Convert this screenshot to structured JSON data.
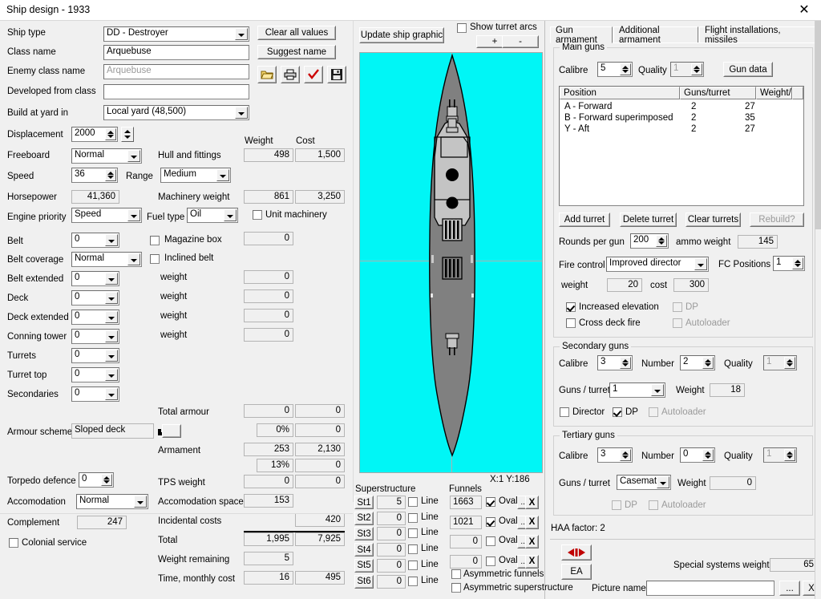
{
  "window": {
    "title": "Ship design - 1933",
    "close_icon": "close-icon"
  },
  "left": {
    "ship_type": {
      "label": "Ship type",
      "value": "DD - Destroyer"
    },
    "class_name": {
      "label": "Class name",
      "value": "Arquebuse"
    },
    "enemy_class_name": {
      "label": "Enemy class name",
      "value": "Arquebuse"
    },
    "developed_from_class": {
      "label": "Developed from class",
      "value": ""
    },
    "build_at_yard": {
      "label": "Build at yard in",
      "value": "Local yard (48,500)"
    },
    "displacement": {
      "label": "Displacement",
      "value": "2000"
    },
    "freeboard": {
      "label": "Freeboard",
      "value": "Normal"
    },
    "speed": {
      "label": "Speed",
      "value": "36"
    },
    "range": {
      "label": "Range",
      "value": "Medium"
    },
    "horsepower": {
      "label": "Horsepower",
      "value": "41,360"
    },
    "engine_priority": {
      "label": "Engine priority",
      "value": "Speed"
    },
    "fuel_type": {
      "label": "Fuel type",
      "value": "Oil"
    },
    "belt": {
      "label": "Belt",
      "value": "0"
    },
    "belt_coverage": {
      "label": "Belt coverage",
      "value": "Normal"
    },
    "belt_extended": {
      "label": "Belt extended",
      "value": "0"
    },
    "deck": {
      "label": "Deck",
      "value": "0"
    },
    "deck_extended": {
      "label": "Deck extended",
      "value": "0"
    },
    "conning_tower": {
      "label": "Conning tower",
      "value": "0"
    },
    "turrets": {
      "label": "Turrets",
      "value": "0"
    },
    "turret_top": {
      "label": "Turret top",
      "value": "0"
    },
    "secondaries": {
      "label": "Secondaries",
      "value": "0"
    },
    "armour_scheme": {
      "label": "Armour scheme",
      "value": "Sloped deck"
    },
    "torpedo_defence": {
      "label": "Torpedo defence",
      "value": "0"
    },
    "accomodation": {
      "label": "Accomodation",
      "value": "Normal"
    },
    "complement": {
      "label": "Complement",
      "value": "247"
    },
    "colonial_service": {
      "label": "Colonial service",
      "checked": false
    },
    "magazine_box": {
      "label": "Magazine box",
      "checked": false
    },
    "inclined_belt": {
      "label": "Inclined belt",
      "checked": false
    },
    "unit_machinery": {
      "label": "Unit machinery",
      "checked": false
    },
    "weight_labels": {
      "weight": "Weight",
      "cost": "Cost"
    },
    "rows": [
      {
        "label": "Hull and fittings",
        "weight": "498",
        "cost": "1,500"
      },
      {
        "label": "Machinery weight",
        "weight": "861",
        "cost": "3,250"
      },
      {
        "label": "weight",
        "weight": "0",
        "cost": ""
      },
      {
        "label": "weight",
        "weight": "0",
        "cost": ""
      },
      {
        "label": "weight",
        "weight": "0",
        "cost": ""
      },
      {
        "label": "weight",
        "weight": "0",
        "cost": ""
      }
    ],
    "total_armour": {
      "label": "Total armour",
      "weight": "0",
      "cost": "0",
      "pct": "0%",
      "pct_cost": "0"
    },
    "armament": {
      "label": "Armament",
      "weight": "253",
      "cost": "2,130",
      "pct": "13%",
      "pct_cost": "0"
    },
    "tps_weight": {
      "label": "TPS weight",
      "weight": "0",
      "cost": "0"
    },
    "accomodation_space": {
      "label": "Accomodation space",
      "weight": "153"
    },
    "incidental_costs": {
      "label": "Incidental costs",
      "cost": "420"
    },
    "total": {
      "label": "Total",
      "weight": "1,995",
      "cost": "7,925"
    },
    "weight_remaining": {
      "label": "Weight remaining",
      "weight": "5"
    },
    "time_monthly_cost": {
      "label": "Time, monthly cost",
      "weight": "16",
      "cost": "495"
    }
  },
  "toolbar": {
    "clear_all_values": "Clear all values",
    "suggest_name": "Suggest name",
    "icons": [
      {
        "name": "open-folder-icon"
      },
      {
        "name": "print-icon"
      },
      {
        "name": "check-icon"
      },
      {
        "name": "save-icon"
      }
    ]
  },
  "graphic": {
    "update_button": "Update ship graphic",
    "show_turret_arcs": {
      "label": "Show turret arcs",
      "checked": false
    },
    "zoom_in": "+",
    "zoom_out": "-",
    "coords": "X:1 Y:186",
    "hull_color": "#808080",
    "superstructure_color": "#c0c0c0",
    "background_color": "#00f6f6"
  },
  "superstructure": {
    "title": "Superstructure",
    "line_label": "Line",
    "rows": [
      {
        "button": "St1",
        "value": "5",
        "line": false
      },
      {
        "button": "St2",
        "value": "0",
        "line": false
      },
      {
        "button": "St3",
        "value": "0",
        "line": false
      },
      {
        "button": "St4",
        "value": "0",
        "line": false
      },
      {
        "button": "St5",
        "value": "0",
        "line": false
      },
      {
        "button": "St6",
        "value": "0",
        "line": false
      }
    ]
  },
  "funnels": {
    "title": "Funnels",
    "oval_label": "Oval",
    "ellipsis": "...",
    "delete": "X",
    "rows": [
      {
        "value": "1663",
        "oval": true,
        "enabled": true
      },
      {
        "value": "1021",
        "oval": true,
        "enabled": true
      },
      {
        "value": "0",
        "oval": false,
        "enabled": false
      },
      {
        "value": "0",
        "oval": false,
        "enabled": false
      }
    ],
    "asymmetric_funnels": {
      "label": "Asymmetric funnels",
      "checked": false
    },
    "asymmetric_superstructure": {
      "label": "Asymmetric superstructure",
      "checked": false
    }
  },
  "right": {
    "tabs": [
      {
        "label": "Gun armament",
        "selected": true
      },
      {
        "label": "Additional armament",
        "selected": false
      },
      {
        "label": "Flight installations, missiles",
        "selected": false
      }
    ],
    "main_guns": {
      "title": "Main guns",
      "calibre": {
        "label": "Calibre",
        "value": "5"
      },
      "quality": {
        "label": "Quality",
        "value": "1"
      },
      "gun_data_button": "Gun data",
      "columns": [
        "Position",
        "Guns/turret",
        "Weight/turret"
      ],
      "rows": [
        {
          "position": "A - Forward",
          "guns": "2",
          "weight": "27"
        },
        {
          "position": "B - Forward superimposed",
          "guns": "2",
          "weight": "35"
        },
        {
          "position": "Y - Aft",
          "guns": "2",
          "weight": "27"
        }
      ],
      "add_turret": "Add turret",
      "delete_turret": "Delete turret",
      "clear_turrets": "Clear turrets",
      "rebuild": "Rebuild?",
      "rounds_per_gun": {
        "label": "Rounds per gun",
        "value": "200"
      },
      "ammo_weight": {
        "label": "ammo weight",
        "value": "145"
      },
      "fire_control": {
        "label": "Fire control",
        "value": "Improved director"
      },
      "fc_positions": {
        "label": "FC Positions",
        "value": "1"
      },
      "weight": {
        "label": "weight",
        "value": "20"
      },
      "cost": {
        "label": "cost",
        "value": "300"
      },
      "increased_elevation": {
        "label": "Increased elevation",
        "checked": true
      },
      "dp": {
        "label": "DP",
        "checked": false,
        "disabled": true
      },
      "cross_deck_fire": {
        "label": "Cross deck fire",
        "checked": false
      },
      "autoloader": {
        "label": "Autoloader",
        "checked": false,
        "disabled": true
      }
    },
    "secondary_guns": {
      "title": "Secondary guns",
      "calibre": {
        "label": "Calibre",
        "value": "3"
      },
      "number": {
        "label": "Number",
        "value": "2"
      },
      "quality": {
        "label": "Quality",
        "value": "1"
      },
      "guns_per_turret": {
        "label": "Guns / turret",
        "value": "1"
      },
      "weight": {
        "label": "Weight",
        "value": "18"
      },
      "director": {
        "label": "Director",
        "checked": false
      },
      "dp": {
        "label": "DP",
        "checked": true
      },
      "autoloader": {
        "label": "Autoloader",
        "checked": false,
        "disabled": true
      }
    },
    "tertiary_guns": {
      "title": "Tertiary guns",
      "calibre": {
        "label": "Calibre",
        "value": "3"
      },
      "number": {
        "label": "Number",
        "value": "0"
      },
      "quality": {
        "label": "Quality",
        "value": "1"
      },
      "guns_per_turret": {
        "label": "Guns / turret",
        "value": "Casemate:"
      },
      "weight": {
        "label": "Weight",
        "value": "0"
      },
      "dp": {
        "label": "DP",
        "checked": false,
        "disabled": true
      },
      "autoloader": {
        "label": "Autoloader",
        "checked": false,
        "disabled": true
      }
    },
    "haa_factor": "HAA factor: 2"
  },
  "bottom": {
    "flip_icon": "left-right-arrows-icon",
    "ea_button": "EA",
    "special_systems_weight": {
      "label": "Special systems weight",
      "value": "65"
    },
    "picture_name": {
      "label": "Picture name",
      "value": ""
    },
    "picture_browse": "...",
    "picture_clear": "X"
  }
}
